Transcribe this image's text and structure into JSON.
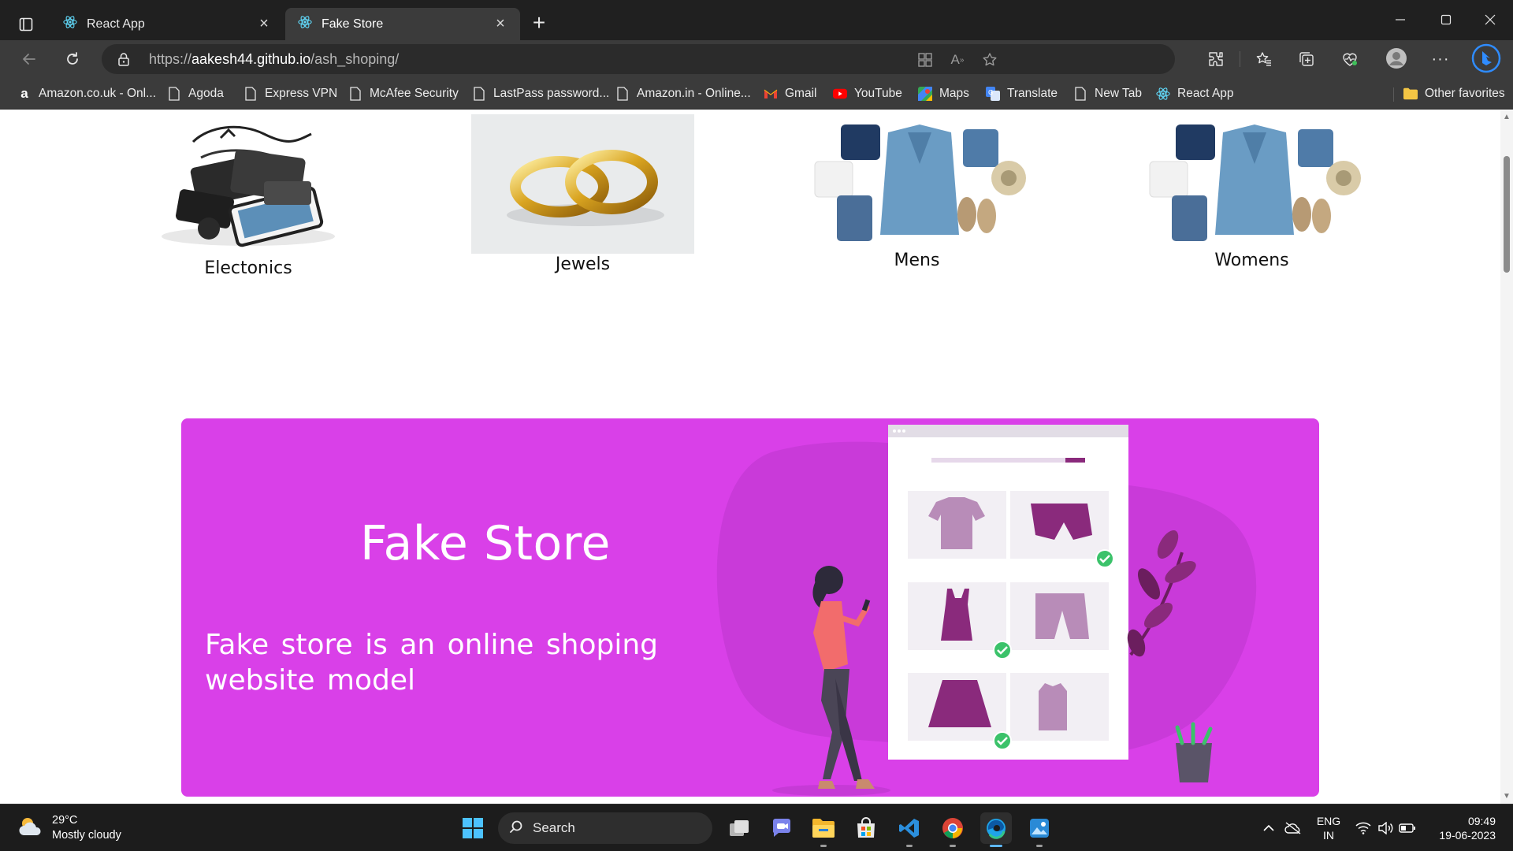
{
  "browser": {
    "tabs": [
      {
        "title": "React App",
        "active": false
      },
      {
        "title": "Fake Store",
        "active": true
      }
    ],
    "url_scheme": "https://",
    "url_host": "aakesh44.github.io",
    "url_path": "/ash_shoping/",
    "favorites": [
      {
        "label": "Amazon.co.uk - Onl...",
        "icon": "amazon-icon"
      },
      {
        "label": "Agoda",
        "icon": "page-icon"
      },
      {
        "label": "Express VPN",
        "icon": "page-icon"
      },
      {
        "label": "McAfee Security",
        "icon": "page-icon"
      },
      {
        "label": "LastPass password...",
        "icon": "page-icon"
      },
      {
        "label": "Amazon.in - Online...",
        "icon": "page-icon"
      },
      {
        "label": "Gmail",
        "icon": "gmail-icon"
      },
      {
        "label": "YouTube",
        "icon": "youtube-icon"
      },
      {
        "label": "Maps",
        "icon": "maps-icon"
      },
      {
        "label": "Translate",
        "icon": "translate-icon"
      },
      {
        "label": "New Tab",
        "icon": "page-icon"
      },
      {
        "label": "React App",
        "icon": "react-icon"
      }
    ],
    "other_favorites": "Other favorites"
  },
  "page": {
    "categories": [
      {
        "label": "Electonics",
        "image": "electronics-pile"
      },
      {
        "label": "Jewels",
        "image": "gold-rings"
      },
      {
        "label": "Mens",
        "image": "clothing-flatlay"
      },
      {
        "label": "Womens",
        "image": "clothing-flatlay"
      }
    ],
    "hero": {
      "title": "Fake Store",
      "description": "Fake store is an online shoping website model",
      "background": "#d940e8"
    }
  },
  "taskbar": {
    "weather_temp": "29°C",
    "weather_desc": "Mostly cloudy",
    "search_label": "Search",
    "lang_line1": "ENG",
    "lang_line2": "IN",
    "time": "09:49",
    "date": "19-06-2023"
  }
}
